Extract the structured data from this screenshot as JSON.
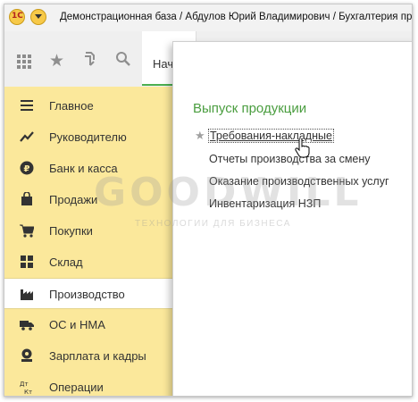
{
  "titlebar": {
    "logo_text": "1С",
    "title": "Демонстрационная база / Абдулов Юрий Владимирович / Бухгалтерия пред"
  },
  "toolbar": {
    "icons": [
      "apps-icon",
      "star-icon",
      "history-icon",
      "search-icon"
    ],
    "active_tab_label": "Нач"
  },
  "sidebar": {
    "items": [
      {
        "label": "Главное",
        "icon": "menu-lines-icon",
        "active": false
      },
      {
        "label": "Руководителю",
        "icon": "trend-chart-icon",
        "active": false
      },
      {
        "label": "Банк и касса",
        "icon": "ruble-coin-icon",
        "active": false
      },
      {
        "label": "Продажи",
        "icon": "shopping-bag-icon",
        "active": false
      },
      {
        "label": "Покупки",
        "icon": "shopping-cart-icon",
        "active": false
      },
      {
        "label": "Склад",
        "icon": "warehouse-grid-icon",
        "active": false
      },
      {
        "label": "Производство",
        "icon": "factory-icon",
        "active": true
      },
      {
        "label": "ОС и НМА",
        "icon": "truck-icon",
        "active": false
      },
      {
        "label": "Зарплата и кадры",
        "icon": "people-icon",
        "active": false
      },
      {
        "label": "Операции",
        "icon": "dt-kt-icon",
        "active": false
      }
    ]
  },
  "panel": {
    "title": "Выпуск продукции",
    "links": [
      "Требования-накладные",
      "Отчеты производства за смену",
      "Оказание производственных услуг",
      "Инвентаризация НЗП"
    ]
  },
  "watermark": {
    "logo": "GOODWILL",
    "subtitle": "ТЕХНОЛОГИИ ДЛЯ БИЗНЕСА"
  },
  "colors": {
    "sidebar_bg": "#fbe89b",
    "panel_title": "#4a9d3f",
    "tab_accent": "#4caf50"
  }
}
